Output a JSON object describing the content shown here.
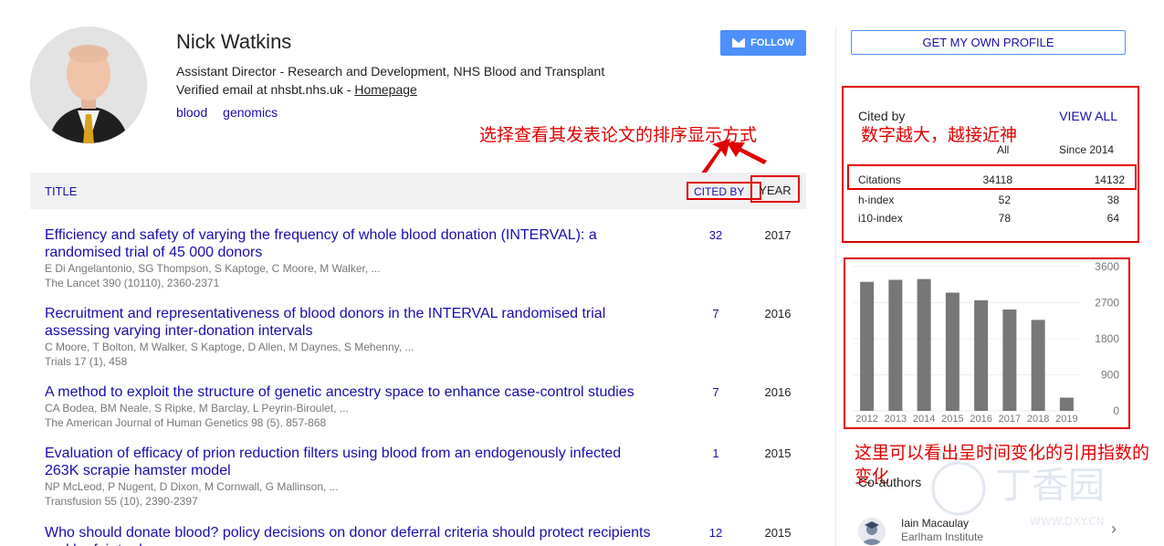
{
  "profile": {
    "name": "Nick Watkins",
    "affiliation": "Assistant Director - Research and Development, NHS Blood and Transplant",
    "verified_email": "Verified email at nhsbt.nhs.uk - ",
    "homepage_label": "Homepage",
    "tags": [
      "blood",
      "genomics"
    ],
    "follow_label": "FOLLOW"
  },
  "table": {
    "title_header": "TITLE",
    "cited_header": "CITED BY",
    "year_header": "YEAR"
  },
  "articles": [
    {
      "title": "Efficiency and safety of varying the frequency of whole blood donation (INTERVAL): a randomised trial of 45 000 donors",
      "authors": "E Di Angelantonio, SG Thompson, S Kaptoge, C Moore, M Walker, ...",
      "venue": "The Lancet 390 (10110), 2360-2371",
      "cited": "32",
      "year": "2017"
    },
    {
      "title": "Recruitment and representativeness of blood donors in the INTERVAL randomised trial assessing varying inter-donation intervals",
      "authors": "C Moore, T Bolton, M Walker, S Kaptoge, D Allen, M Daynes, S Mehenny, ...",
      "venue": "Trials 17 (1), 458",
      "cited": "7",
      "year": "2016"
    },
    {
      "title": "A method to exploit the structure of genetic ancestry space to enhance case-control studies",
      "authors": "CA Bodea, BM Neale, S Ripke, M Barclay, L Peyrin-Biroulet, ...",
      "venue": "The American Journal of Human Genetics 98 (5), 857-868",
      "cited": "7",
      "year": "2016"
    },
    {
      "title": "Evaluation of efficacy of prion reduction filters using blood from an endogenously infected 263K scrapie hamster model",
      "authors": "NP McLeod, P Nugent, D Dixon, M Cornwall, G Mallinson, ...",
      "venue": "Transfusion 55 (10), 2390-2397",
      "cited": "1",
      "year": "2015"
    },
    {
      "title": "Who should donate blood? policy decisions on donor deferral criteria should protect recipients and be fair to donors",
      "authors": "",
      "venue": "",
      "cited": "12",
      "year": "2015"
    }
  ],
  "sidebar": {
    "get_profile_label": "GET MY OWN PROFILE",
    "cited_by_label": "Cited by",
    "view_all_label": "VIEW ALL",
    "col_all": "All",
    "col_since": "Since 2014",
    "metrics": [
      {
        "name": "Citations",
        "all": "34118",
        "since": "14132"
      },
      {
        "name": "h-index",
        "all": "52",
        "since": "38"
      },
      {
        "name": "i10-index",
        "all": "78",
        "since": "64"
      }
    ],
    "coauthors_label": "Co-authors",
    "coauthors": [
      {
        "name": "Iain Macaulay",
        "institution": "Earlham Institute"
      }
    ]
  },
  "chart_data": {
    "type": "bar",
    "categories": [
      "2012",
      "2013",
      "2014",
      "2015",
      "2016",
      "2017",
      "2018",
      "2019"
    ],
    "values": [
      3220,
      3270,
      3290,
      2950,
      2760,
      2530,
      2270,
      330
    ],
    "yticks": [
      "3600",
      "2700",
      "1800",
      "900",
      "0"
    ],
    "ylim": [
      0,
      3600
    ],
    "bar_color": "#777777",
    "grid": true
  },
  "annotations": {
    "sort_note": "选择查看其发表论文的排序显示方式",
    "index_note": "数字越大，越接近神",
    "chart_note": "这里可以看出呈时间变化的引用指数的变化",
    "arrow_color": "#e00000"
  },
  "watermark": {
    "text": "丁香园",
    "sub": "WWW.DXY.CN"
  }
}
